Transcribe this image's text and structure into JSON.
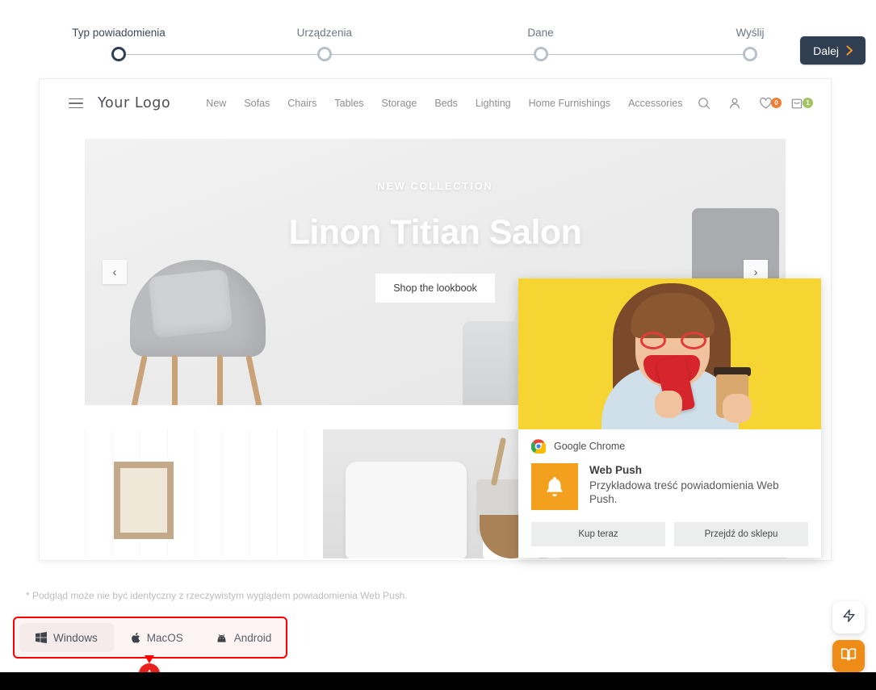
{
  "stepper": {
    "steps": [
      {
        "label": "Typ powiadomienia",
        "active": true
      },
      {
        "label": "Urządzenia",
        "active": false
      },
      {
        "label": "Dane",
        "active": false
      },
      {
        "label": "Wyślij",
        "active": false
      }
    ],
    "next_label": "Dalej",
    "active_color": "#2f3f51",
    "inactive_color": "#b9c0c8",
    "accent_color": "#f0922b"
  },
  "shop": {
    "logo": "Your Logo",
    "nav": [
      "New",
      "Sofas",
      "Chairs",
      "Tables",
      "Storage",
      "Beds",
      "Lighting",
      "Home Furnishings",
      "Accessories"
    ],
    "icons": {
      "search": "search-icon",
      "account": "user-icon",
      "wishlist": "heart-icon",
      "cart": "bag-icon"
    },
    "wishlist_count": "0",
    "cart_count": "1",
    "wishlist_badge_color": "#f07d34",
    "cart_badge_color": "#a5c261",
    "hero": {
      "kicker": "NEW COLLECTION",
      "title": "Linon Titian Salon",
      "cta": "Shop the lookbook",
      "prev_arrow": "‹",
      "next_arrow": "›"
    }
  },
  "push": {
    "source": "Google Chrome",
    "title": "Web Push",
    "text": "Przykładowa treść powiadomienia Web Push.",
    "actions": [
      "Kup teraz",
      "Przejdź do sklepu"
    ],
    "image_bg": "#f6d432",
    "app_icon_bg": "#f2a01e",
    "app_icon_name": "bell-icon"
  },
  "footnote": "* Podgląd może nie być identyczny z rzeczywistym wyglądem powiadomienia Web Push.",
  "os_tabs": {
    "items": [
      {
        "label": "Windows",
        "icon": "windows-icon",
        "active": true
      },
      {
        "label": "MacOS",
        "icon": "apple-icon",
        "active": false
      },
      {
        "label": "Android",
        "icon": "android-icon",
        "active": false
      }
    ],
    "highlight_color": "#ff0000",
    "marker_label": "A",
    "marker_color": "#e8211c"
  },
  "floating_buttons": [
    {
      "name": "bolt-icon",
      "color": "#2f3f51",
      "background": "#ffffff"
    },
    {
      "name": "book-icon",
      "color": "#ffffff",
      "background": "#ef8b17"
    }
  ]
}
